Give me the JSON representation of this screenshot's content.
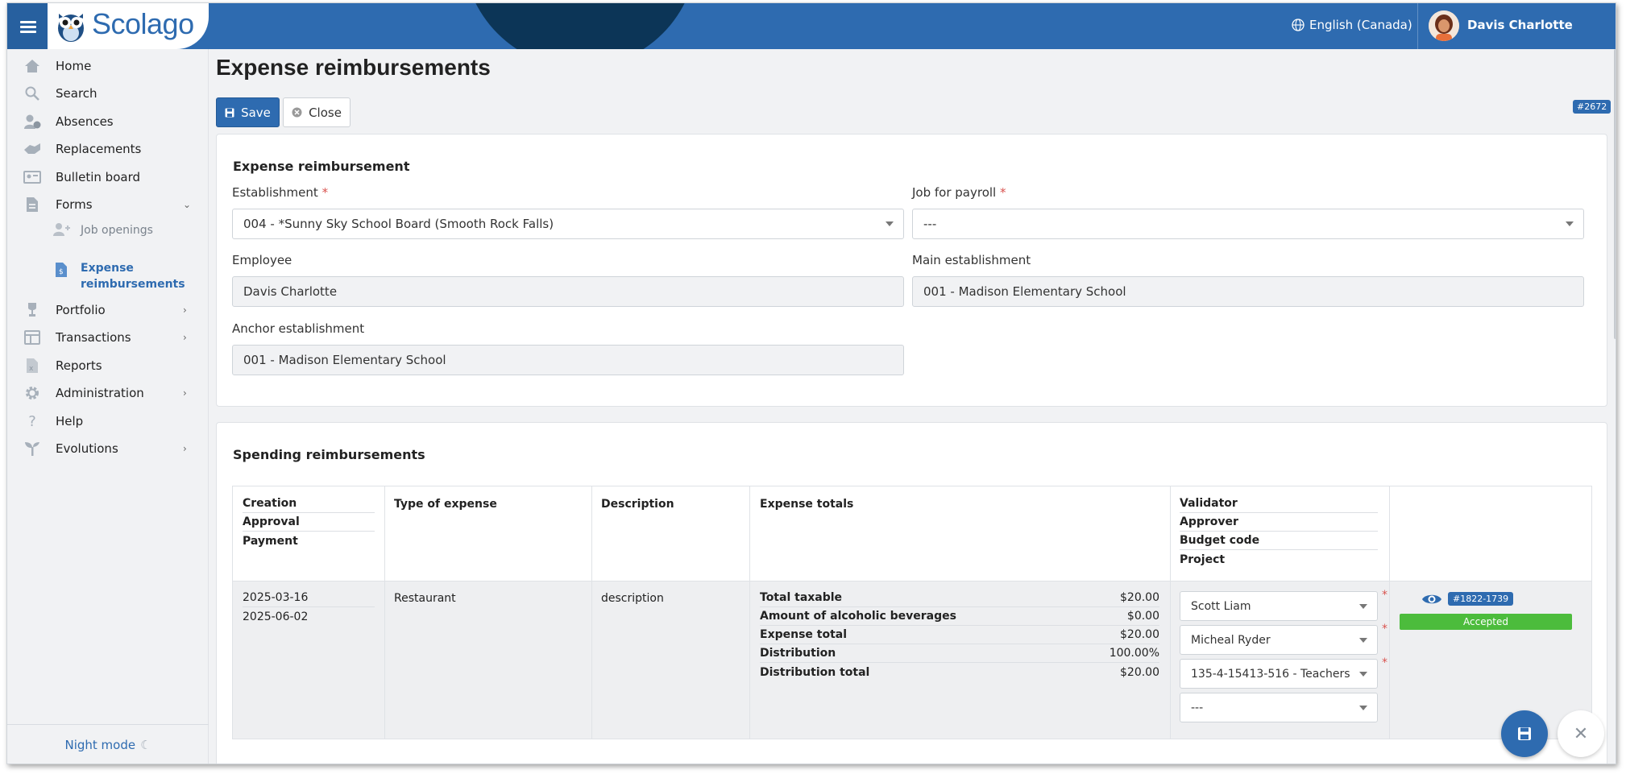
{
  "app": {
    "logo_text": "Scolago",
    "language": "English (Canada)",
    "user_name": "Davis Charlotte"
  },
  "sidebar": {
    "items": [
      {
        "label": "Home",
        "icon": "home-icon"
      },
      {
        "label": "Search",
        "icon": "search-icon"
      },
      {
        "label": "Absences",
        "icon": "absence-icon"
      },
      {
        "label": "Replacements",
        "icon": "replacement-icon"
      },
      {
        "label": "Bulletin board",
        "icon": "bulletin-icon"
      },
      {
        "label": "Forms",
        "icon": "forms-icon"
      },
      {
        "label": "Portfolio",
        "icon": "trophy-icon"
      },
      {
        "label": "Transactions",
        "icon": "transactions-icon"
      },
      {
        "label": "Reports",
        "icon": "reports-icon"
      },
      {
        "label": "Administration",
        "icon": "gear-icon"
      },
      {
        "label": "Help",
        "icon": "help-icon"
      },
      {
        "label": "Evolutions",
        "icon": "sprout-icon"
      }
    ],
    "sub_items": [
      {
        "label": "Job openings"
      },
      {
        "label_line1": "Expense",
        "label_line2": "reimbursements"
      }
    ],
    "night_mode": "Night mode"
  },
  "page": {
    "title": "Expense reimbursements",
    "save_label": "Save",
    "close_label": "Close",
    "id_badge": "#2672"
  },
  "form": {
    "title": "Expense reimbursement",
    "establishment_label": "Establishment",
    "establishment_value": "004 - *Sunny Sky School Board (Smooth Rock Falls)",
    "job_payroll_label": "Job for payroll",
    "job_payroll_value": "---",
    "employee_label": "Employee",
    "employee_value": "Davis Charlotte",
    "main_est_label": "Main establishment",
    "main_est_value": "001 - Madison Elementary School",
    "anchor_est_label": "Anchor establishment",
    "anchor_est_value": "001 - Madison Elementary School",
    "required_mark": "*"
  },
  "spending": {
    "title": "Spending reimbursements",
    "headers": {
      "creation": "Creation",
      "approval": "Approval",
      "payment": "Payment",
      "type": "Type of expense",
      "description": "Description",
      "totals": "Expense totals",
      "validator": "Validator",
      "approver": "Approver",
      "budget_code": "Budget code",
      "project": "Project"
    },
    "row": {
      "creation_date": "2025-03-16",
      "approval_date": "2025-06-02",
      "type": "Restaurant",
      "description": "description",
      "totals": [
        {
          "label": "Total taxable",
          "value": "$20.00"
        },
        {
          "label": "Amount of alcoholic beverages",
          "value": "$0.00"
        },
        {
          "label": "Expense total",
          "value": "$20.00"
        },
        {
          "label": "Distribution",
          "value": "100.00%"
        },
        {
          "label": "Distribution total",
          "value": "$20.00"
        }
      ],
      "validator": "Scott Liam",
      "approver": "Micheal Ryder",
      "budget_code": "135-4-15413-516 - Teachers",
      "project": "---",
      "badge": "#1822-1739",
      "status": "Accepted"
    }
  },
  "colors": {
    "primary": "#2e6bb0",
    "accepted": "#4cbc3c",
    "required": "#d9534f"
  }
}
